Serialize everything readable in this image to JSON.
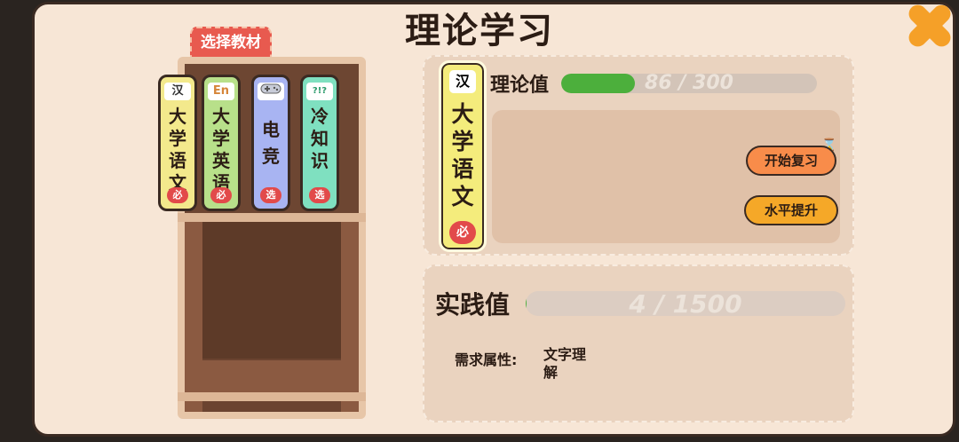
{
  "title": "理论学习",
  "select_tag": "选择教材",
  "books": [
    {
      "icon": "汉",
      "name": "大学语文",
      "badge": "必",
      "color": "#f3e98c"
    },
    {
      "icon": "En",
      "name": "大学英语",
      "badge": "必",
      "color": "#b8e08a"
    },
    {
      "icon": "gamepad-icon",
      "name": "电竞",
      "badge": "选",
      "color": "#a8b4f2"
    },
    {
      "icon": "?!?",
      "name": "冷知识",
      "badge": "选",
      "color": "#7fe0c0"
    }
  ],
  "selected_book": {
    "icon": "汉",
    "name": "大学语文",
    "badge": "必"
  },
  "theory": {
    "label": "理论值",
    "current": 86,
    "max": 300,
    "text": "86 / 300"
  },
  "buttons": {
    "review": "开始复习",
    "upgrade": "水平提升"
  },
  "practice": {
    "label": "实践值",
    "current": 4,
    "max": 1500,
    "text": "4 / 1500"
  },
  "requirement": {
    "label": "需求属性:",
    "value": "文字理解"
  }
}
